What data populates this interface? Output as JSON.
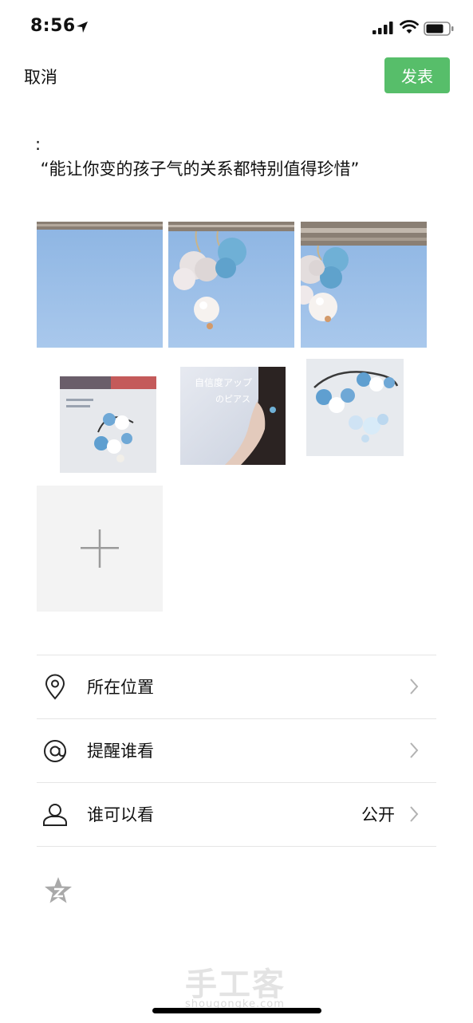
{
  "status_bar": {
    "time": "8:56"
  },
  "header": {
    "cancel_label": "取消",
    "publish_label": "发表"
  },
  "post": {
    "text_line1": ":",
    "text_line2": " “能让你变的孩子气的关系都特别值得珍惜”"
  },
  "photos": {
    "photo5_overlay_line1": "自信度アップ",
    "photo5_overlay_line2": "のピアス"
  },
  "options": {
    "location_label": "所在位置",
    "remind_label": "提醒谁看",
    "visibility_label": "谁可以看",
    "visibility_value": "公开"
  },
  "watermark": {
    "cn": "手工客",
    "en": "shougongke.com"
  },
  "colors": {
    "accent_green": "#57be6a",
    "sky_blue": "#9cc0e8"
  },
  "icons": [
    "navigation-arrow-icon",
    "signal-icon",
    "wifi-icon",
    "battery-icon",
    "plus-icon",
    "location-pin-icon",
    "at-icon",
    "person-icon",
    "chevron-right-icon",
    "star-icon"
  ]
}
